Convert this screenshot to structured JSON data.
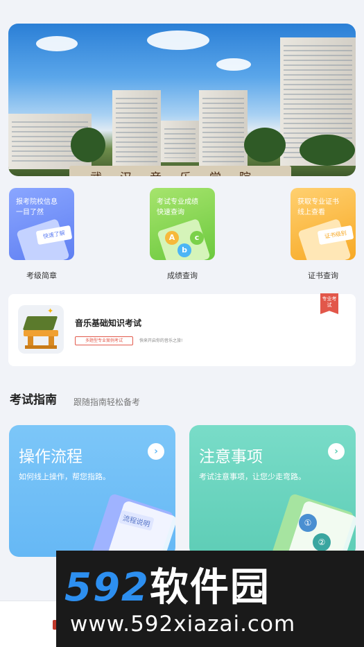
{
  "banner": {
    "image_alt": "campus",
    "gate_text": "武汉音乐学院"
  },
  "quick_cards": [
    {
      "line1": "报考院校信息",
      "line2": "一目了然",
      "tag": "快速了解",
      "label": "考级简章"
    },
    {
      "line1": "考试专业成绩",
      "line2": "快速查询",
      "tag": "",
      "label": "成绩查询"
    },
    {
      "line1": "获取专业证书",
      "line2": "线上查看",
      "tag": "证书级别",
      "label": "证书查询"
    }
  ],
  "exam": {
    "title": "音乐基础知识考试",
    "tag": "多题型专业案例考试",
    "subtitle": "快来开启你的音乐之旅!",
    "ribbon": "专业考试"
  },
  "guide": {
    "title": "考试指南",
    "subtitle": "跟随指南轻松备考",
    "cards": [
      {
        "title": "操作流程",
        "subtitle": "如何线上操作，帮您指路。",
        "deco_label": "流程说明"
      },
      {
        "title": "注意事项",
        "subtitle": "考试注意事项，让您少走弯路。",
        "deco_label": ""
      }
    ]
  },
  "watermark": {
    "number": "592",
    "brand": "软件园",
    "url": "www.592xiazai.com"
  },
  "colors": {
    "accent_red": "#e2574a",
    "blue_card": "#66b8f5",
    "teal_card": "#5ecdb6"
  }
}
